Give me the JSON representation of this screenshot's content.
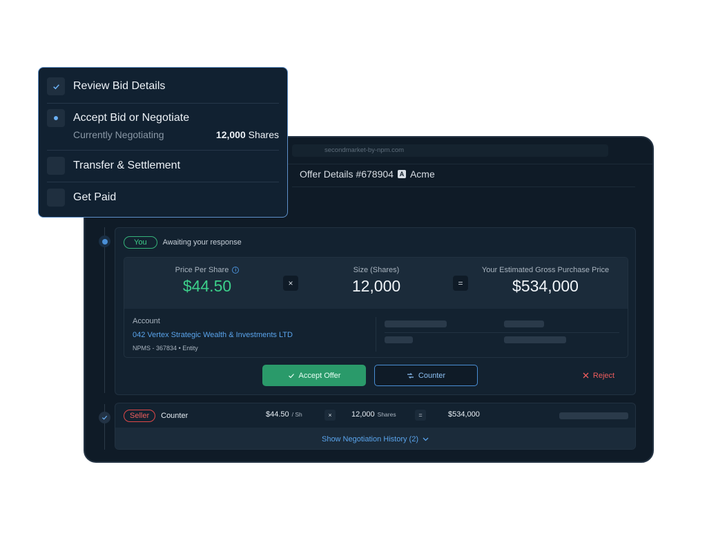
{
  "browser": {
    "url": "secondmarket-by-npm.com"
  },
  "offer": {
    "title": "Offer Details #678904",
    "company_logo_letter": "A",
    "company": "Acme"
  },
  "current_card": {
    "party": "You",
    "status": "Awaiting your response",
    "price_label": "Price Per Share",
    "price_value": "$44.50",
    "size_label": "Size (Shares)",
    "size_value": "12,000",
    "total_label": "Your Estimated Gross Purchase Price",
    "total_value": "$534,000",
    "multiply_symbol": "×",
    "equals_symbol": "=",
    "account_label": "Account",
    "account_name": "042 Vertex Strategic Wealth & Investments LTD",
    "account_id": "NPMS - 367834",
    "account_type": "Entity",
    "accept_label": "Accept Offer",
    "counter_label": "Counter",
    "reject_label": "Reject"
  },
  "seller_row": {
    "party": "Seller",
    "action": "Counter",
    "price": "$44.50",
    "price_unit": "/ Sh",
    "shares": "12,000",
    "shares_unit": "Shares",
    "total": "$534,000",
    "multiply_symbol": "×",
    "equals_symbol": "=",
    "history_label": "Show Negotiation History (2)"
  },
  "steps": [
    {
      "label": "Review Bid Details",
      "state": "done"
    },
    {
      "label": "Accept Bid or Negotiate",
      "state": "active",
      "sub": "Currently Negotiating",
      "shares_count": "12,000",
      "shares_unit": "Shares"
    },
    {
      "label": "Transfer & Settlement",
      "state": "pending"
    },
    {
      "label": "Get Paid",
      "state": "pending"
    }
  ],
  "colors": {
    "accent_blue": "#4a8fd6",
    "accept_green": "#2a9a6a",
    "price_green": "#3ccf8a",
    "reject_red": "#ef5d5d",
    "panel_bg": "#0f1b27"
  }
}
